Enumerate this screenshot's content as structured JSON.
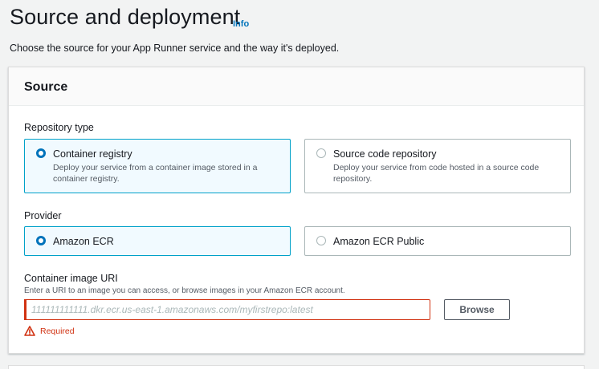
{
  "header": {
    "title": "Source and deployment",
    "info_label": "Info",
    "description": "Choose the source for your App Runner service and the way it's deployed."
  },
  "source_panel": {
    "title": "Source",
    "repository_type": {
      "label": "Repository type",
      "options": [
        {
          "title": "Container registry",
          "description": "Deploy your service from a container image stored in a container registry.",
          "selected": true
        },
        {
          "title": "Source code repository",
          "description": "Deploy your service from code hosted in a source code repository.",
          "selected": false
        }
      ]
    },
    "provider": {
      "label": "Provider",
      "options": [
        {
          "title": "Amazon ECR",
          "selected": true
        },
        {
          "title": "Amazon ECR Public",
          "selected": false
        }
      ]
    },
    "container_image_uri": {
      "label": "Container image URI",
      "description": "Enter a URI to an image you can access, or browse images in your Amazon ECR account.",
      "value": "",
      "placeholder": "111111111111.dkr.ecr.us-east-1.amazonaws.com/myfirstrepo:latest",
      "browse_label": "Browse",
      "error": "Required"
    }
  },
  "colors": {
    "accent": "#0073bb",
    "selected_border": "#00a1c9",
    "selected_bg": "#f1faff",
    "error": "#d13212"
  },
  "icons": {
    "error": "warning-triangle-icon"
  }
}
